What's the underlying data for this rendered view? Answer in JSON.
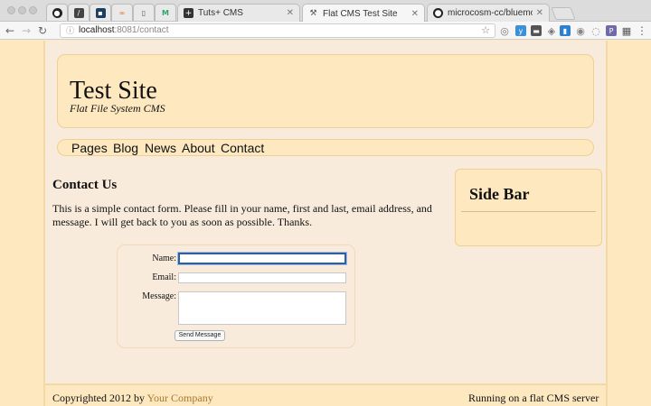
{
  "browser": {
    "tabs": [
      {
        "title": "Tuts+ CMS",
        "icon": "tuts-icon",
        "active": false
      },
      {
        "title": "Flat CMS Test Site",
        "icon": "hammer-icon",
        "active": true
      },
      {
        "title": "microcosm-cc/bluemonday: bl",
        "icon": "github-icon",
        "active": false
      }
    ],
    "url_host": "localhost",
    "url_path": ":8081/contact",
    "accent": "#2f5f9e"
  },
  "site": {
    "title": "Test Site",
    "tagline": "Flat File System CMS",
    "nav": [
      "Pages",
      "Blog",
      "News",
      "About",
      "Contact"
    ]
  },
  "main": {
    "heading": "Contact Us",
    "intro": "This is a simple contact form. Please fill in your name, first and last, email address, and message. I will get back to you as soon as possible. Thanks.",
    "form": {
      "name_label": "Name:",
      "email_label": "Email:",
      "message_label": "Message:",
      "name_value": "",
      "email_value": "",
      "message_value": "",
      "send_label": "Send Message"
    }
  },
  "sidebar": {
    "title": "Side Bar"
  },
  "footer": {
    "copyright_prefix": "Copyrighted 2012 by ",
    "company_link": "Your Company",
    "right_text": "Running on a flat CMS server"
  }
}
